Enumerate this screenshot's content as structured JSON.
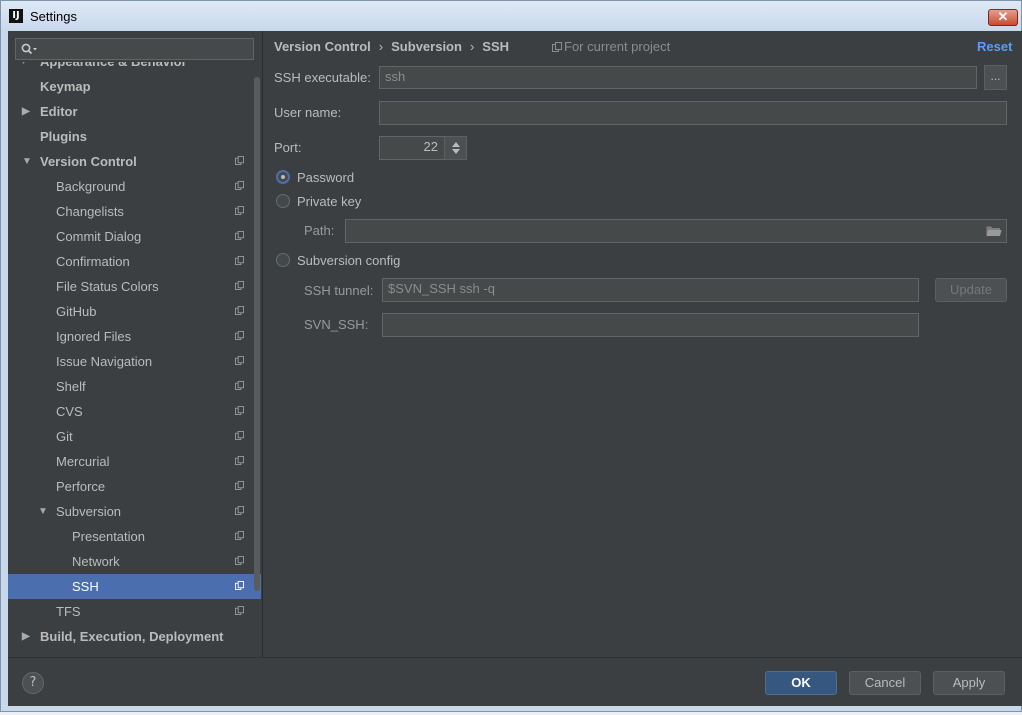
{
  "window": {
    "title": "Settings",
    "app_icon": "IJ",
    "close_label": "✕"
  },
  "sidebar": {
    "search": {
      "placeholder": "",
      "value": ""
    },
    "items": [
      {
        "label": "Appearance & Behavior",
        "level": 0,
        "bold": true,
        "arrow": "›",
        "partial": true
      },
      {
        "label": "Keymap",
        "level": 0,
        "bold": true
      },
      {
        "label": "Editor",
        "level": 0,
        "bold": true,
        "arrow": "▶"
      },
      {
        "label": "Plugins",
        "level": 0,
        "bold": true
      },
      {
        "label": "Version Control",
        "level": 0,
        "bold": true,
        "arrow": "▼",
        "project": true
      },
      {
        "label": "Background",
        "level": 1,
        "project": true
      },
      {
        "label": "Changelists",
        "level": 1,
        "project": true
      },
      {
        "label": "Commit Dialog",
        "level": 1,
        "project": true
      },
      {
        "label": "Confirmation",
        "level": 1,
        "project": true
      },
      {
        "label": "File Status Colors",
        "level": 1,
        "project": true
      },
      {
        "label": "GitHub",
        "level": 1,
        "project": true
      },
      {
        "label": "Ignored Files",
        "level": 1,
        "project": true
      },
      {
        "label": "Issue Navigation",
        "level": 1,
        "project": true
      },
      {
        "label": "Shelf",
        "level": 1,
        "project": true
      },
      {
        "label": "CVS",
        "level": 1,
        "project": true
      },
      {
        "label": "Git",
        "level": 1,
        "project": true
      },
      {
        "label": "Mercurial",
        "level": 1,
        "project": true
      },
      {
        "label": "Perforce",
        "level": 1,
        "project": true
      },
      {
        "label": "Subversion",
        "level": 1,
        "arrow": "▼",
        "project": true
      },
      {
        "label": "Presentation",
        "level": 2,
        "project": true
      },
      {
        "label": "Network",
        "level": 2,
        "project": true
      },
      {
        "label": "SSH",
        "level": 2,
        "project": true,
        "selected": true
      },
      {
        "label": "TFS",
        "level": 1,
        "project": true
      },
      {
        "label": "Build, Execution, Deployment",
        "level": 0,
        "bold": true,
        "arrow": "▶"
      }
    ]
  },
  "main": {
    "breadcrumb": [
      "Version Control",
      "Subversion",
      "SSH"
    ],
    "breadcrumb_sep": "›",
    "project_hint": "For current project",
    "reset_label": "Reset",
    "ssh_executable": {
      "label": "SSH executable:",
      "value": "ssh",
      "browse_label": "..."
    },
    "user_name": {
      "label": "User name:",
      "value": ""
    },
    "port": {
      "label": "Port:",
      "value": "22"
    },
    "auth": {
      "password_label": "Password",
      "private_key_label": "Private key",
      "path_label": "Path:",
      "path_value": "",
      "subversion_config_label": "Subversion config",
      "selected": "password"
    },
    "ssh_tunnel": {
      "label": "SSH tunnel:",
      "value": "$SVN_SSH ssh -q",
      "update_label": "Update"
    },
    "svn_ssh": {
      "label": "SVN_SSH:",
      "value": ""
    }
  },
  "footer": {
    "help_label": "?",
    "ok_label": "OK",
    "cancel_label": "Cancel",
    "apply_label": "Apply"
  },
  "colors": {
    "background": "#3c3f41",
    "selection": "#4b6eaf",
    "link": "#589df6",
    "text": "#bbbbbb"
  }
}
